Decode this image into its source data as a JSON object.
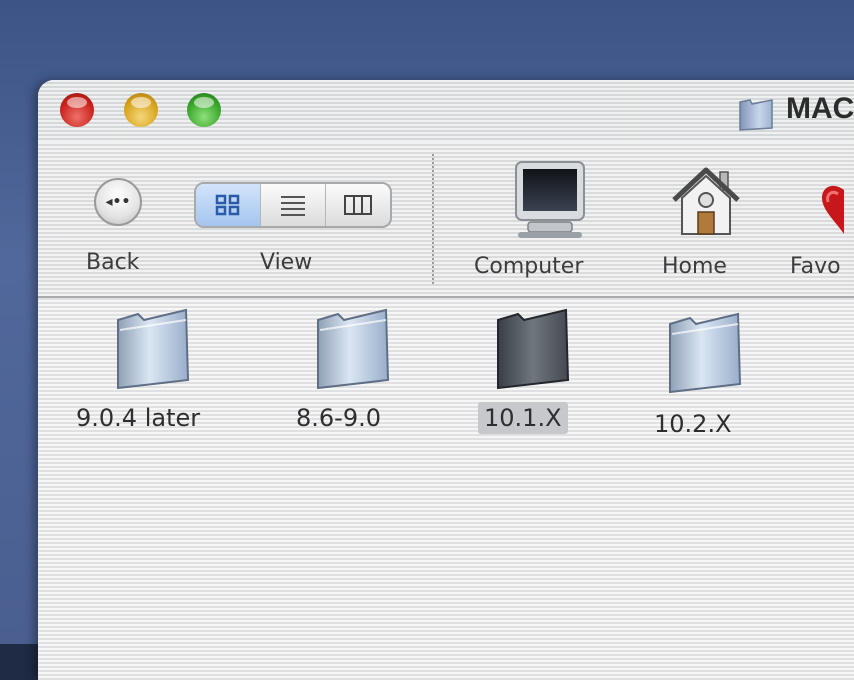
{
  "window": {
    "title": "MAC",
    "controls": [
      "close",
      "minimize",
      "zoom"
    ]
  },
  "toolbar": {
    "back": {
      "label": "Back",
      "icon": "back-arrow-icon"
    },
    "view": {
      "label": "View",
      "modes": [
        {
          "name": "icon-view",
          "active": true
        },
        {
          "name": "list-view",
          "active": false
        },
        {
          "name": "column-view",
          "active": false
        }
      ]
    },
    "places": [
      {
        "label": "Computer",
        "icon": "computer-icon"
      },
      {
        "label": "Home",
        "icon": "home-icon"
      },
      {
        "label": "Favo",
        "icon": "favorites-heart-icon"
      }
    ]
  },
  "files": [
    {
      "name": "9.0.4 later",
      "selected": false
    },
    {
      "name": "8.6-9.0",
      "selected": false
    },
    {
      "name": "10.1.X",
      "selected": true
    },
    {
      "name": "10.2.X",
      "selected": false
    }
  ],
  "colors": {
    "desktop": "#4a5f90",
    "selection": "#c6c8cb",
    "close": "#c8231c",
    "minimize": "#d8a31d",
    "zoom": "#38a52a"
  }
}
